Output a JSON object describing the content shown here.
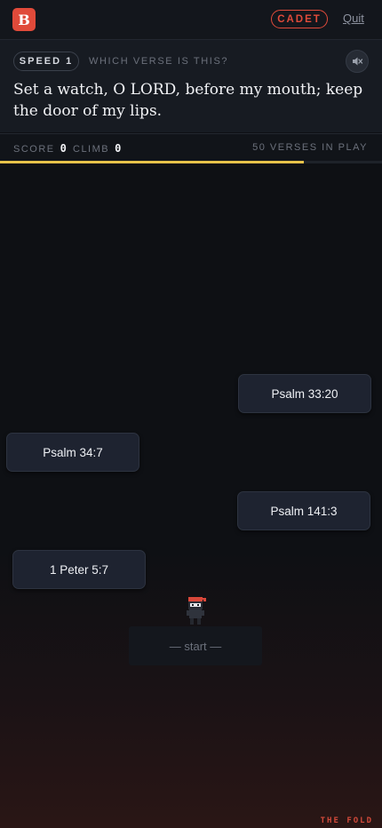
{
  "header": {
    "logo_letter": "B",
    "rank_badge": "CADET",
    "quit_label": "Quit"
  },
  "question": {
    "speed_label": "SPEED 1",
    "prompt": "WHICH VERSE IS THIS?",
    "sound_icon": "speaker-muted-icon",
    "verse_text": "Set a watch, O LORD, before my mouth; keep the door of my lips."
  },
  "stats": {
    "score_label": "SCORE",
    "score_value": "0",
    "climb_label": "CLIMB",
    "climb_value": "0",
    "verses_in_play": "50 VERSES IN PLAY"
  },
  "progress": {
    "fraction": 0.795,
    "color": "#e7c24a"
  },
  "choices": [
    {
      "label": "Psalm 33:20"
    },
    {
      "label": "Psalm 34:7"
    },
    {
      "label": "Psalm 141:3"
    },
    {
      "label": "1 Peter 5:7"
    }
  ],
  "start_label": "— start —",
  "brand": "THE FOLD",
  "colors": {
    "accent": "#e04a3a",
    "background": "#0e1014",
    "panel": "#171b22"
  }
}
